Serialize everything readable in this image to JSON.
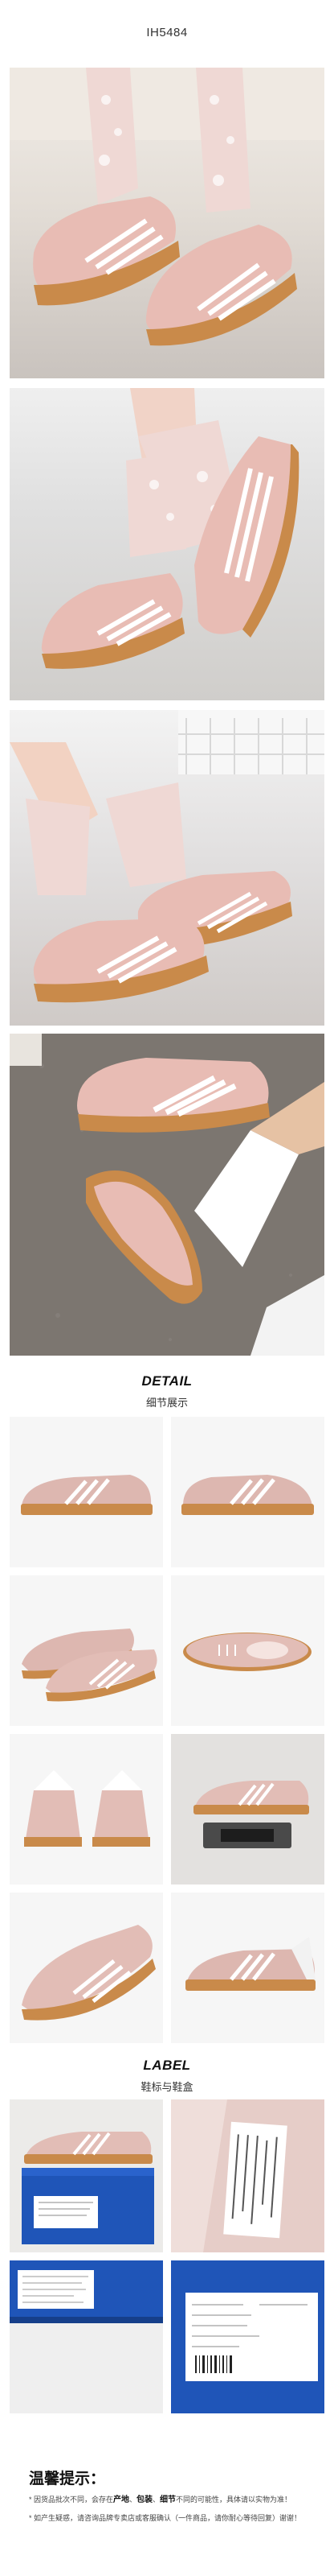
{
  "header": {
    "product_code": "IH5484"
  },
  "detail": {
    "title_en": "DETAIL",
    "title_cn": "细节展示"
  },
  "label_section": {
    "title_en": "LABEL",
    "title_cn": "鞋标与鞋盒"
  },
  "colors": {
    "shoe_pink": "#e8bcb4",
    "stripe_white": "#ffffff",
    "gum_sole": "#c98a4a",
    "box_blue": "#1f55b8"
  },
  "tips": {
    "heading": "温馨提示：",
    "line1_prefix": "* 因货品批次不同，会存在",
    "line1_bold1": "产地",
    "line1_sep1": "、",
    "line1_bold2": "包装",
    "line1_sep2": "、",
    "line1_bold3": "细节",
    "line1_suffix": "不同的可能性，具体请以实物为准！",
    "line2": "* 如产生疑惑，请咨询品牌专卖店或客服确认（一件商品，请你耐心等待回复）谢谢！"
  }
}
